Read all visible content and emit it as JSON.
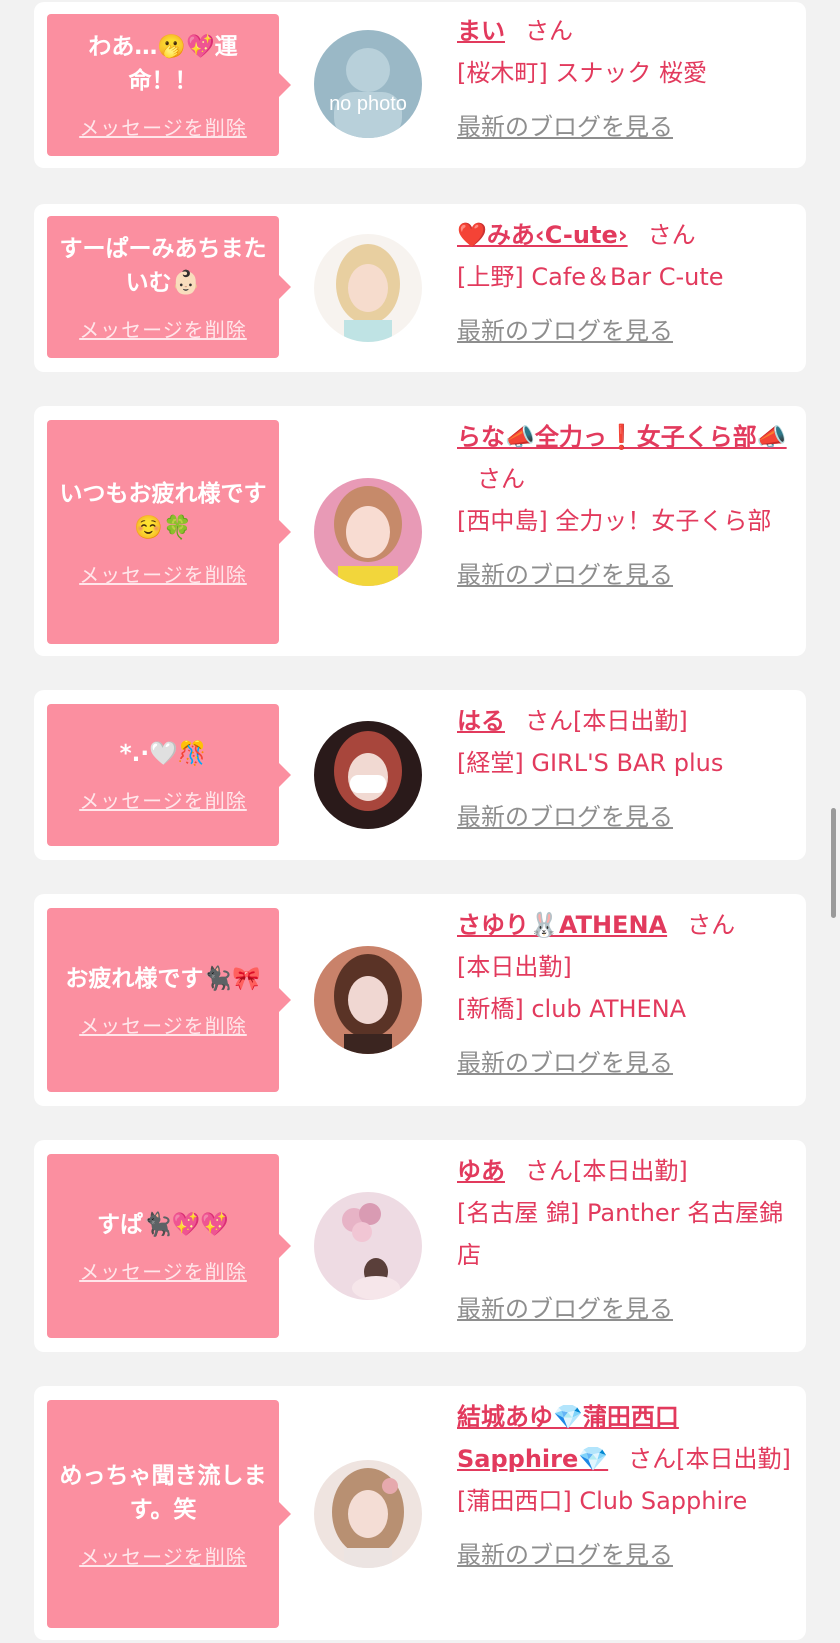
{
  "colors": {
    "bubble": "#fb8fa0",
    "accent": "#e23a5d",
    "link_gray": "#8e8e8e",
    "background": "#f2f2f2"
  },
  "items": [
    {
      "message": "わあ…🫢💖運命！！",
      "delete_label": "メッセージを削除",
      "avatar": "no-photo-avatar",
      "avatar_text": "no photo",
      "name": "まい",
      "san": "さん",
      "badge": "",
      "shop": "[桜木町] スナック 桜愛",
      "blog_label": "最新のブログを見る"
    },
    {
      "message": "すーぱーみあちまたいむ👶🏻",
      "delete_label": "メッセージを削除",
      "avatar": "girl-avatar",
      "name": "❤️みあ‹C-ute›",
      "san": "さん",
      "badge": "",
      "shop": "[上野] Cafe＆Bar C-ute",
      "blog_label": "最新のブログを見る"
    },
    {
      "message": "いつもお疲れ様です☺️🍀",
      "delete_label": "メッセージを削除",
      "avatar": "girl-avatar",
      "name": "らな📣全力っ❗女子くら部📣",
      "san": "さん",
      "badge": "",
      "shop": "[西中島] 全力ッ！女子くら部",
      "blog_label": "最新のブログを見る"
    },
    {
      "message": "*.·🤍🎊",
      "delete_label": "メッセージを削除",
      "avatar": "girl-avatar",
      "name": "はる",
      "san": "さん",
      "badge": "[本日出勤]",
      "shop": "[経堂] GIRL'S BAR plus",
      "blog_label": "最新のブログを見る"
    },
    {
      "message": "お疲れ様です🐈‍⬛🎀",
      "delete_label": "メッセージを削除",
      "avatar": "girl-avatar",
      "name": "さゆり🐰ATHENA",
      "san": "さん",
      "badge": "[本日出勤]",
      "shop": "[新橋] club ATHENA",
      "blog_label": "最新のブログを見る"
    },
    {
      "message": "すぱ🐈‍⬛💖💖",
      "delete_label": "メッセージを削除",
      "avatar": "girl-avatar",
      "name": "ゆあ",
      "san": "さん",
      "badge": "[本日出勤]",
      "shop": "[名古屋 錦] Panther 名古屋錦店",
      "blog_label": "最新のブログを見る"
    },
    {
      "message": "めっちゃ聞き流します。笑",
      "delete_label": "メッセージを削除",
      "avatar": "girl-avatar",
      "name": "結城あゆ💎蒲田西口Sapphire💎",
      "san": "さん",
      "badge": "[本日出勤]",
      "shop": "[蒲田西口] Club Sapphire",
      "blog_label": "最新のブログを見る"
    }
  ]
}
